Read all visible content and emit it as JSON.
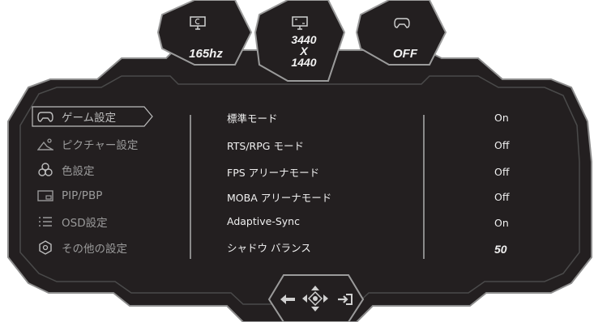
{
  "status": {
    "refresh_rate": "165hz",
    "resolution_line1": "3440",
    "resolution_line2": "X",
    "resolution_line3": "1440",
    "gamepad_state": "OFF"
  },
  "menu": {
    "items": [
      {
        "label": "ゲーム設定",
        "icon": "gamepad-icon",
        "active": true
      },
      {
        "label": "ピクチャー設定",
        "icon": "picture-icon",
        "active": false
      },
      {
        "label": "色設定",
        "icon": "color-icon",
        "active": false
      },
      {
        "label": "PIP/PBP",
        "icon": "pip-icon",
        "active": false
      },
      {
        "label": "OSD設定",
        "icon": "osd-list-icon",
        "active": false
      },
      {
        "label": "その他の設定",
        "icon": "settings-icon",
        "active": false
      }
    ]
  },
  "options": [
    {
      "label": "標準モード",
      "value": "On"
    },
    {
      "label": "RTS/RPG モード",
      "value": "Off"
    },
    {
      "label": "FPS アリーナモード",
      "value": "Off"
    },
    {
      "label": "MOBA アリーナモード",
      "value": "Off"
    },
    {
      "label": "Adaptive-Sync",
      "value": "On"
    },
    {
      "label": "シャドウ バランス",
      "value": "50"
    }
  ],
  "colors": {
    "panel": "#231f20",
    "border": "#9b9b9b",
    "text": "#f0f0f0",
    "muted_text": "#9a9a9a"
  },
  "nav": {
    "icons": [
      "back-arrow-icon",
      "dpad-icon",
      "exit-icon"
    ]
  }
}
